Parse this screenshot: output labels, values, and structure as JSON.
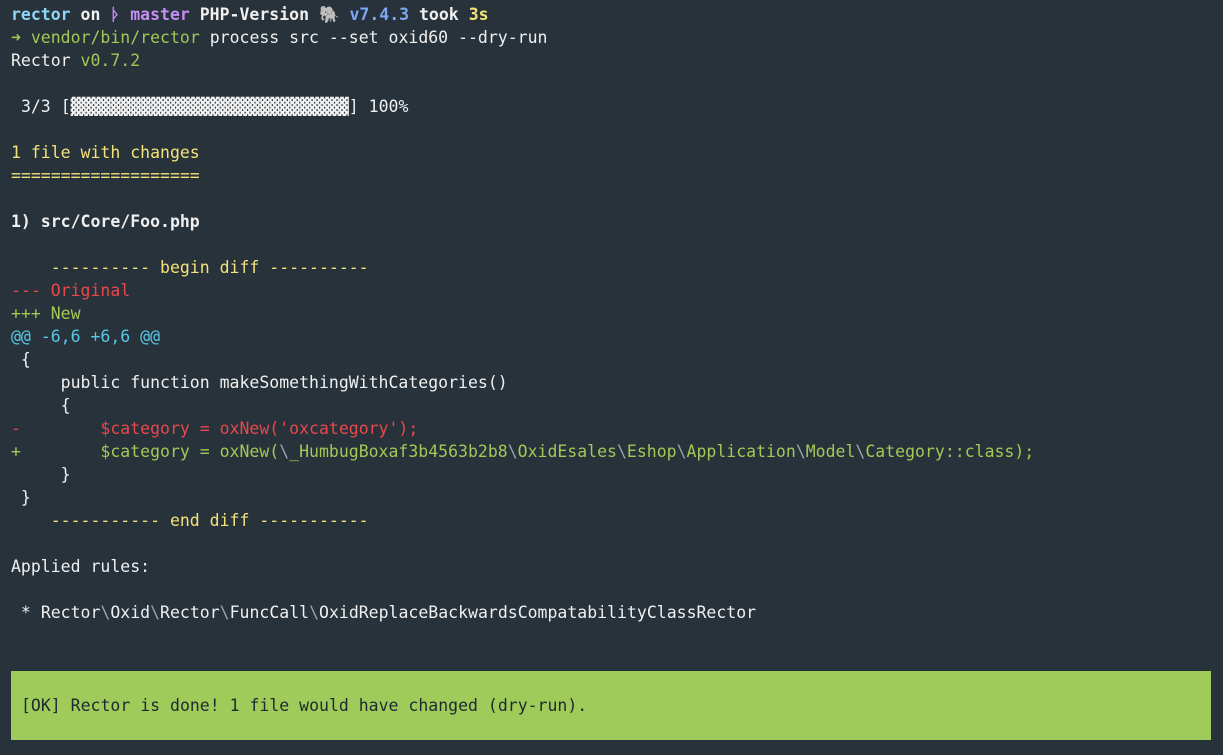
{
  "prompt": {
    "dir": "rector",
    "on": "on",
    "branch_icon": "git-branch-icon",
    "branch_glyph": "ᚦ",
    "branch": "master",
    "php_label": "PHP-Version",
    "php_icon": "elephant-icon",
    "php_glyph": "🐘",
    "php_version": "v7.4.3",
    "took": "took",
    "took_time": "3s"
  },
  "command": {
    "arrow": "➜",
    "bin": "vendor/bin/rector",
    "args": "process src --set oxid60 --dry-run"
  },
  "version_line": {
    "name": "Rector",
    "version": "v0.7.2"
  },
  "progress": {
    "count": "3/3",
    "bar_open": "[",
    "bar": "▓▓▓▓▓▓▓▓▓▓▓▓▓▓▓▓▓▓▓▓▓▓▓▓▓▓▓▓",
    "bar_close": "]",
    "percent_text": "100%",
    "fraction": 1.0
  },
  "summary": {
    "changes": "1 file with changes",
    "rule": "==================="
  },
  "file": {
    "title": "1) src/Core/Foo.php"
  },
  "diff": {
    "begin": "    ---------- begin diff ----------",
    "original": "--- Original",
    "new": "+++ New",
    "hunk": "@@ -6,6 +6,6 @@",
    "ctx1": " {",
    "ctx2": "     public function makeSomethingWithCategories()",
    "ctx3": "     {",
    "minus_sign": "-",
    "minus_code": "        $category = oxNew('oxcategory');",
    "plus_sign": "+",
    "plus_code_pre": "        $category = oxNew(",
    "plus_ns": [
      "\\",
      "_HumbugBoxaf3b4563b2b8",
      "\\",
      "OxidEsales",
      "\\",
      "Eshop",
      "\\",
      "Application",
      "\\",
      "Model",
      "\\",
      "Category::class);"
    ],
    "ctx4": "     }",
    "ctx5": " }",
    "end": "    ----------- end diff -----------"
  },
  "rules": {
    "heading": "Applied rules:",
    "bullet": " * ",
    "parts": [
      "Rector",
      "\\",
      "Oxid",
      "\\",
      "Rector",
      "\\",
      "FuncCall",
      "\\",
      "OxidReplaceBackwardsCompatabilityClassRector"
    ]
  },
  "ok_message": "[OK] Rector is done! 1 file would have changed (dry-run).",
  "colors": {
    "background": "#27323a",
    "ok_background": "#9fcb5a",
    "added": "#a1c957",
    "removed": "#e8484b",
    "heading": "#f3e37a"
  }
}
